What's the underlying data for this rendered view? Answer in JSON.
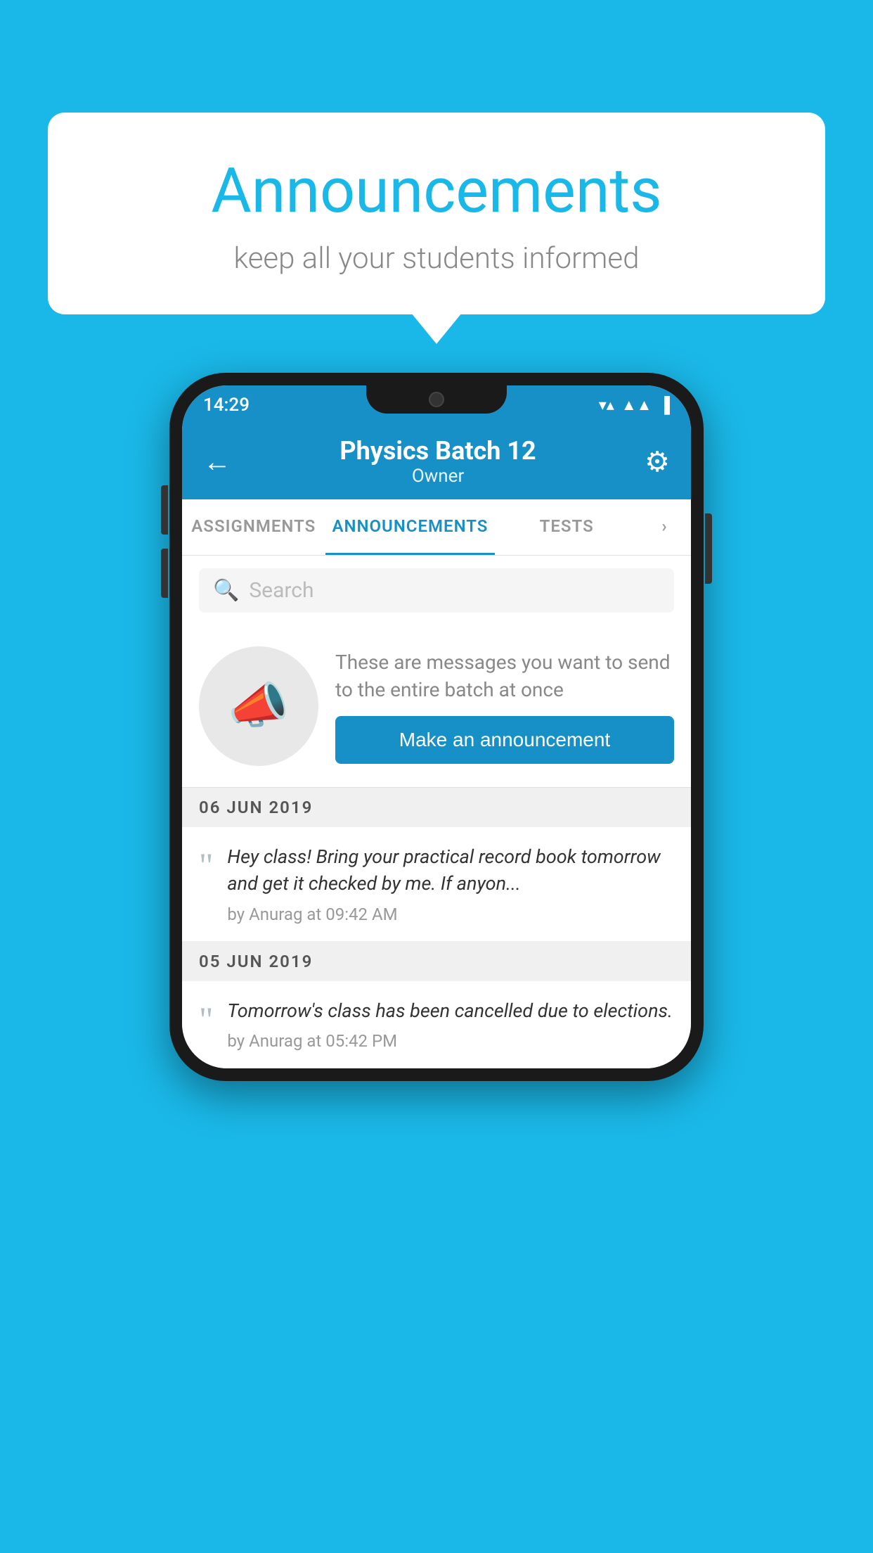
{
  "bubble": {
    "title": "Announcements",
    "subtitle": "keep all your students informed"
  },
  "status_bar": {
    "time": "14:29",
    "wifi": "▼",
    "signal": "▲",
    "battery": "▌"
  },
  "header": {
    "title": "Physics Batch 12",
    "subtitle": "Owner",
    "back_label": "←",
    "settings_label": "⚙"
  },
  "tabs": [
    {
      "label": "ASSIGNMENTS",
      "active": false
    },
    {
      "label": "ANNOUNCEMENTS",
      "active": true
    },
    {
      "label": "TESTS",
      "active": false
    },
    {
      "label": "›",
      "active": false
    }
  ],
  "search": {
    "placeholder": "Search"
  },
  "promo": {
    "text": "These are messages you want to send to the entire batch at once",
    "button_label": "Make an announcement"
  },
  "date_groups": [
    {
      "date": "06  JUN  2019",
      "announcements": [
        {
          "text": "Hey class! Bring your practical record book tomorrow and get it checked by me. If anyon...",
          "meta": "by Anurag at 09:42 AM"
        }
      ]
    },
    {
      "date": "05  JUN  2019",
      "announcements": [
        {
          "text": "Tomorrow's class has been cancelled due to elections.",
          "meta": "by Anurag at 05:42 PM"
        }
      ]
    }
  ]
}
